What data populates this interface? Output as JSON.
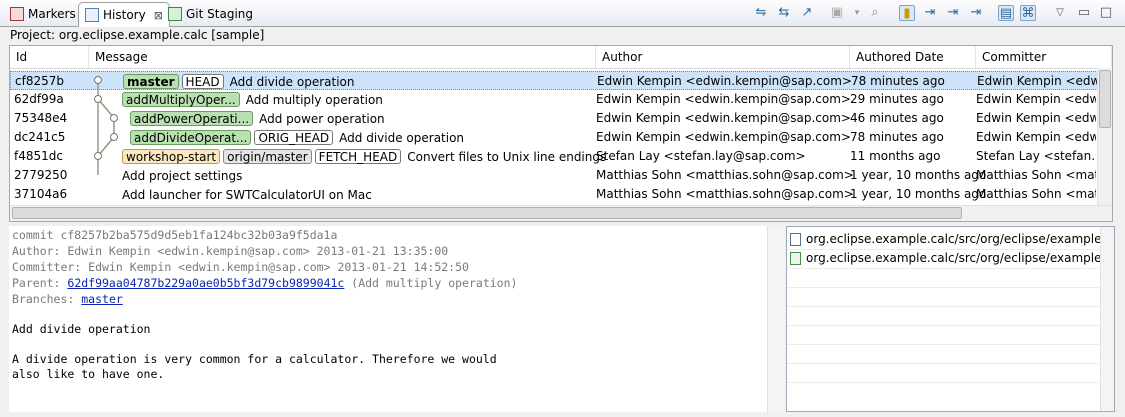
{
  "tabs": [
    {
      "label": "Markers",
      "icon": "markers-icon",
      "active": false
    },
    {
      "label": "History",
      "icon": "history-icon",
      "active": true,
      "close": "⊠"
    },
    {
      "label": "Git Staging",
      "icon": "git-staging-icon",
      "active": false
    }
  ],
  "toolbar": {
    "icons": [
      "link-with-selection-icon",
      "compare-mode-icon",
      "show-all-branches-icon",
      "collapse-icon",
      "search-icon",
      "show-all-changes-icon",
      "filter-resource-icon",
      "filter-folder-icon",
      "filter-project-icon",
      "filter-repository-icon",
      "show-find-toolbar-icon",
      "show-comment-icon",
      "view-menu-icon",
      "minimize-icon",
      "maximize-icon"
    ]
  },
  "project_label": "Project: org.eclipse.example.calc [sample]",
  "columns": [
    "Id",
    "Message",
    "Author",
    "Authored Date",
    "Committer"
  ],
  "commits": [
    {
      "id": "cf8257b",
      "refs": [
        {
          "name": "master",
          "kind": "branch",
          "bold": true
        },
        {
          "name": "HEAD",
          "kind": "plain"
        }
      ],
      "message": "Add divide operation",
      "author": "Edwin Kempin <edwin.kempin@sap.com>",
      "date": "78 minutes ago",
      "committer": "Edwin Kempin <edwi",
      "selected": true
    },
    {
      "id": "62df99a",
      "refs": [
        {
          "name": "addMultiplyOper...",
          "kind": "branch"
        }
      ],
      "message": "Add multiply operation",
      "author": "Edwin Kempin <edwin.kempin@sap.com>",
      "date": "29 minutes ago",
      "committer": "Edwin Kempin <edwi"
    },
    {
      "id": "75348e4",
      "refs": [
        {
          "name": "addPowerOperati...",
          "kind": "branch"
        }
      ],
      "message": "Add power operation",
      "author": "Edwin Kempin <edwin.kempin@sap.com>",
      "date": "46 minutes ago",
      "committer": "Edwin Kempin <edwi"
    },
    {
      "id": "dc241c5",
      "refs": [
        {
          "name": "addDivideOperat...",
          "kind": "branch"
        },
        {
          "name": "ORIG_HEAD",
          "kind": "plain"
        }
      ],
      "message": "Add divide operation",
      "author": "Edwin Kempin <edwin.kempin@sap.com>",
      "date": "78 minutes ago",
      "committer": "Edwin Kempin <edwi"
    },
    {
      "id": "f4851dc",
      "refs": [
        {
          "name": "workshop-start",
          "kind": "tag"
        },
        {
          "name": "origin/master",
          "kind": "remote"
        },
        {
          "name": "FETCH_HEAD",
          "kind": "plain"
        }
      ],
      "message": "Convert files to Unix line endings",
      "author": "Stefan Lay <stefan.lay@sap.com>",
      "date": "11 months ago",
      "committer": "Stefan Lay <stefan.lay@"
    },
    {
      "id": "2779250",
      "refs": [],
      "message": "Add project settings",
      "author": "Matthias Sohn <matthias.sohn@sap.com>",
      "date": "1 year, 10 months ago",
      "committer": "Matthias Sohn <matth"
    },
    {
      "id": "37104a6",
      "refs": [],
      "message": "Add launcher for SWTCalculatorUI on Mac",
      "author": "Matthias Sohn <matthias.sohn@sap.com>",
      "date": "1 year, 10 months ago",
      "committer": "Matthias Sohn <matth"
    }
  ],
  "details": {
    "commit": "commit cf8257b2ba575d9d5eb1fa124bc32b03a9f5da1a",
    "author": "Author: Edwin Kempin <edwin.kempin@sap.com> 2013-01-21 13:35:00",
    "committer": "Committer: Edwin Kempin <edwin.kempin@sap.com> 2013-01-21 14:52:50",
    "parent_label": "Parent: ",
    "parent_hash": "62df99aa04787b229a0ae0b5bf3d79cb9899041c",
    "parent_note": " (Add multiply operation)",
    "branches_label": "Branches: ",
    "branch": "master",
    "subject": "Add divide operation",
    "body1": "A divide operation is very common for a calculator. Therefore we would",
    "body2": "also like to have one."
  },
  "files": [
    {
      "path": "org.eclipse.example.calc/src/org/eclipse/example/calc/int",
      "icon": "modified-file-icon"
    },
    {
      "path": "org.eclipse.example.calc/src/org/eclipse/example/calc/int",
      "icon": "added-file-icon"
    }
  ]
}
